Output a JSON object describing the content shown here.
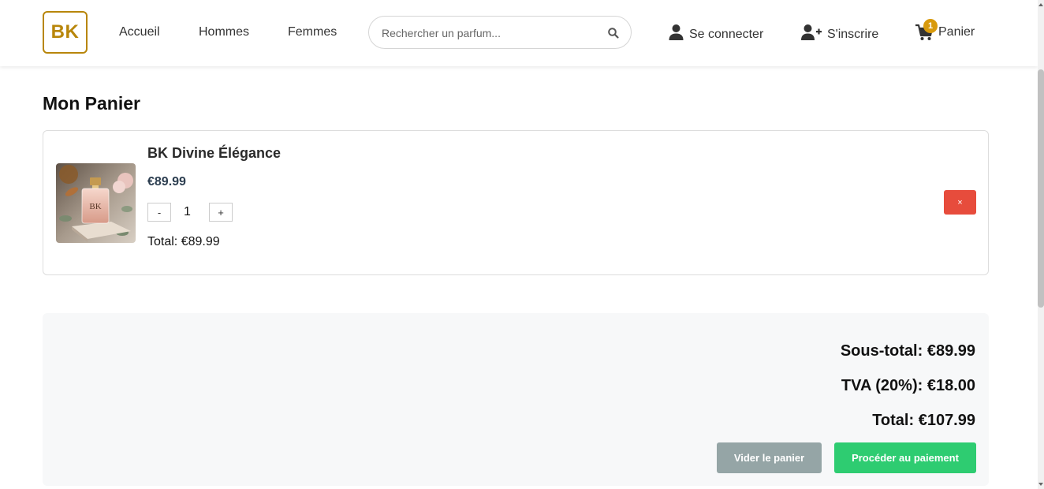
{
  "header": {
    "logo_text": "BK",
    "nav": [
      {
        "label": "Accueil"
      },
      {
        "label": "Hommes"
      },
      {
        "label": "Femmes"
      }
    ],
    "search": {
      "placeholder": "Rechercher un parfum...",
      "value": "",
      "icon": "search-icon"
    },
    "login_label": "Se connecter",
    "signup_label": "S'inscrire",
    "cart_label": "Panier",
    "cart_count": "1"
  },
  "page": {
    "title": "Mon Panier"
  },
  "cart": {
    "items": [
      {
        "name": "BK Divine Élégance",
        "price": "€89.99",
        "quantity": "1",
        "decrement_label": "-",
        "increment_label": "+",
        "total": "Total: €89.99",
        "remove_label": "×"
      }
    ]
  },
  "summary": {
    "subtotal": "Sous-total: €89.99",
    "tax": "TVA (20%): €18.00",
    "total": "Total: €107.99",
    "clear_label": "Vider le panier",
    "checkout_label": "Procéder au paiement"
  },
  "colors": {
    "brand": "#b8860b",
    "badge": "#d89a0c",
    "remove": "#e74c3c",
    "clear": "#95a5a6",
    "checkout": "#2ecc71",
    "price": "#2c3e50"
  }
}
